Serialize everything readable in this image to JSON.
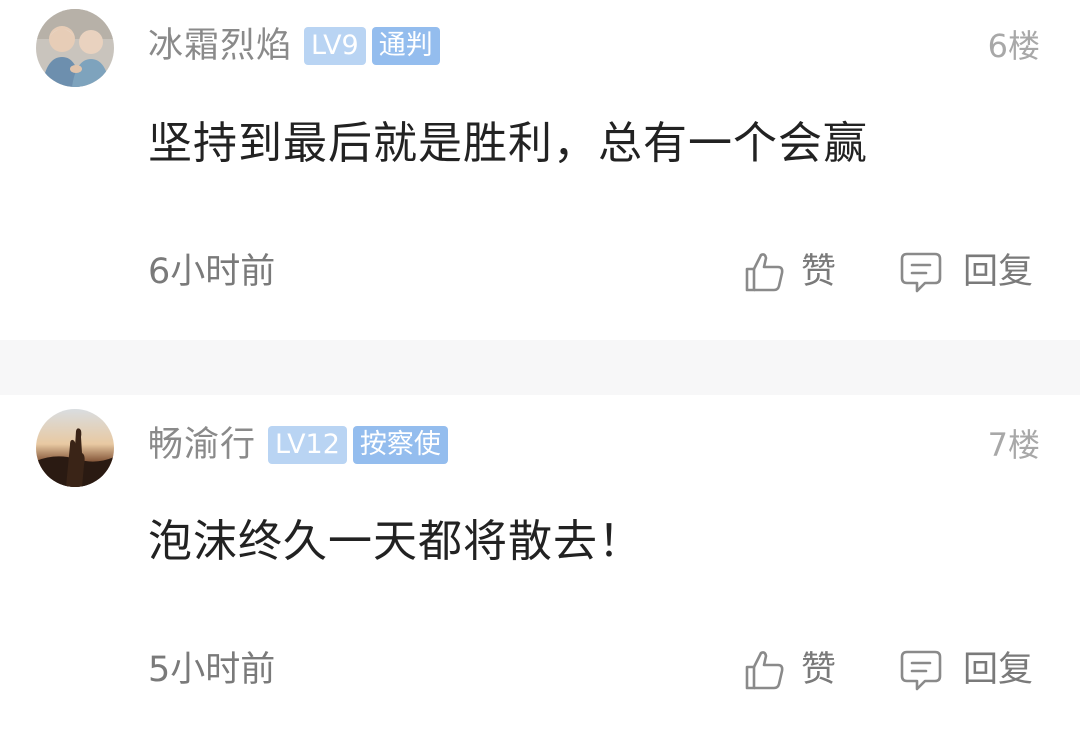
{
  "comments": [
    {
      "username": "冰霜烈焰",
      "level": "LV9",
      "title": "通判",
      "floor": "6楼",
      "content": "坚持到最后就是胜利，总有一个会赢",
      "time": "6小时前",
      "like_label": "赞",
      "reply_label": "回复",
      "avatar_icon": "elderly-couple-photo"
    },
    {
      "username": "畅渝行",
      "level": "LV12",
      "title": "按察使",
      "floor": "7楼",
      "content": "泡沫终久一天都将散去！",
      "time": "5小时前",
      "like_label": "赞",
      "reply_label": "回复",
      "avatar_icon": "sunset-hand-photo"
    }
  ],
  "colors": {
    "badge_level_bg": "#b9d4f3",
    "badge_title_bg": "#94bdee",
    "username": "#8a8a8a",
    "content": "#222222",
    "meta": "#7a7a7a",
    "divider": "#f7f7f8"
  },
  "icons": {
    "like": "thumbs-up-icon",
    "reply": "comment-bubble-icon"
  }
}
